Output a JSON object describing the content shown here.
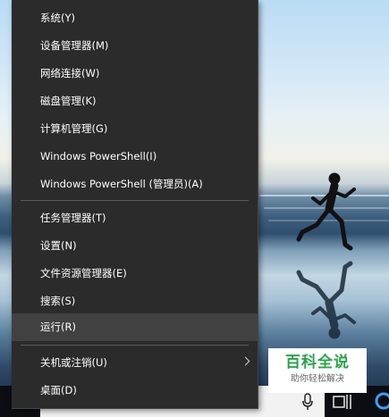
{
  "menu": {
    "items": [
      {
        "label": "系统(Y)"
      },
      {
        "label": "设备管理器(M)"
      },
      {
        "label": "网络连接(W)"
      },
      {
        "label": "磁盘管理(K)"
      },
      {
        "label": "计算机管理(G)"
      },
      {
        "label": "Windows PowerShell(I)"
      },
      {
        "label": "Windows PowerShell (管理员)(A)"
      },
      {
        "label": "任务管理器(T)"
      },
      {
        "label": "设置(N)"
      },
      {
        "label": "文件资源管理器(E)"
      },
      {
        "label": "搜索(S)"
      },
      {
        "label": "运行(R)"
      },
      {
        "label": "关机或注销(U)"
      },
      {
        "label": "桌面(D)"
      }
    ],
    "highlighted": "运行(R)"
  },
  "taskbar": {
    "icons": [
      "mic-icon",
      "task-view-icon",
      "cortana-icon"
    ]
  },
  "watermark": {
    "title": "百科全说",
    "subtitle": "助你轻松解决"
  },
  "colors": {
    "menu_bg": "#2b2b2b",
    "menu_hover": "#414141",
    "menu_text": "#ffffff",
    "taskbar": "#0b0d12",
    "watermark_green": "#2aa44a"
  }
}
